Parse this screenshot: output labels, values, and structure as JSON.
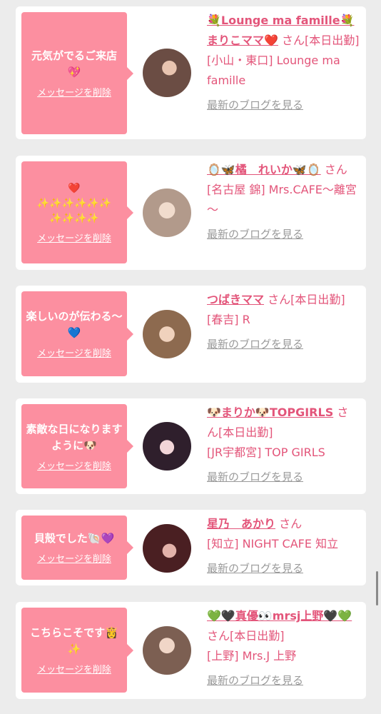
{
  "cards": [
    {
      "message": "元気がでるご来店💖",
      "delete_label": "メッセージを削除",
      "name": "💐Lounge ma famille💐まりこママ❤️",
      "san": "さん",
      "status": "[本日出勤]",
      "store": "[小山・東口] Lounge ma famille",
      "blog_label": "最新のブログを見る",
      "avatar_color": "#8b6f63"
    },
    {
      "message": "❤️\n✨✨✨✨✨✨\n✨✨✨✨",
      "delete_label": "メッセージを削除",
      "name": "🪞🦋橘　れいか🦋🪞",
      "san": "さん",
      "status": "",
      "store": "[名古屋 錦] Mrs.CAFE～離宮～",
      "blog_label": "最新のブログを見る",
      "avatar_color": "#c7b4a7"
    },
    {
      "message": "楽しいのが伝わる〜💙",
      "delete_label": "メッセージを削除",
      "name": "つばきママ",
      "san": "さん",
      "status": "[本日出勤]",
      "store": "[春吉] R",
      "blog_label": "最新のブログを見る",
      "avatar_color": "#a88868"
    },
    {
      "message": "素敵な日になりますように🐶",
      "delete_label": "メッセージを削除",
      "name": "🐶まりか🐶TOPGIRLS",
      "san": "さん",
      "status": "[本日出勤]",
      "store": "[JR宇都宮] TOP GIRLS",
      "blog_label": "最新のブログを見る",
      "avatar_color": "#3b2a37"
    },
    {
      "message": "貝殻でした🐚💜",
      "delete_label": "メッセージを削除",
      "name": "星乃　あかり",
      "san": "さん",
      "status": "",
      "store": "[知立] NIGHT CAFE 知立",
      "blog_label": "最新のブログを見る",
      "avatar_color": "#5a2c2e"
    },
    {
      "message": "こちらこそです👸✨",
      "delete_label": "メッセージを削除",
      "name": "💚🖤真優👀mrsj上野🖤💚",
      "san": "さん",
      "status": "[本日出勤]",
      "store": "[上野] Mrs.J 上野",
      "blog_label": "最新のブログを見る",
      "avatar_color": "#9c7c6c"
    }
  ]
}
